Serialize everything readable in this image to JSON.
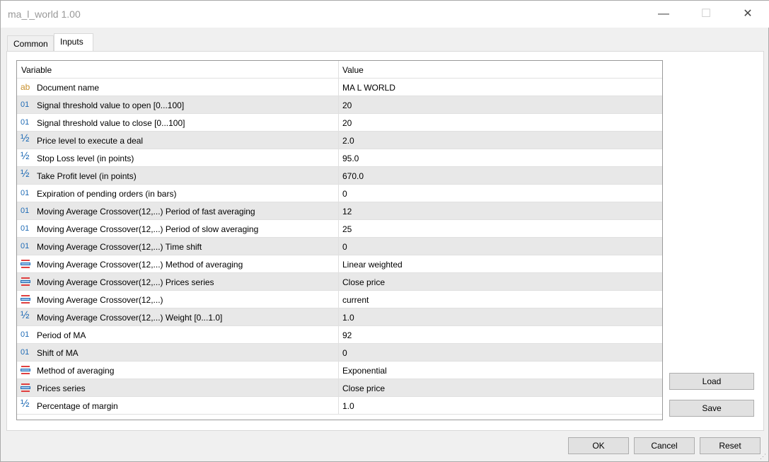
{
  "window": {
    "title": "ma_l_world 1.00",
    "minimize": "—",
    "maximize": "☐",
    "close": "✕"
  },
  "tabs": [
    {
      "label": "Common"
    },
    {
      "label": "Inputs"
    }
  ],
  "grid": {
    "headers": {
      "variable": "Variable",
      "value": "Value"
    },
    "rows": [
      {
        "icon": "string",
        "variable": "Document name",
        "value": "MA L WORLD"
      },
      {
        "icon": "int",
        "variable": "Signal threshold value to open [0...100]",
        "value": "20"
      },
      {
        "icon": "int",
        "variable": "Signal threshold value to close [0...100]",
        "value": "20"
      },
      {
        "icon": "double",
        "variable": "Price level to execute a deal",
        "value": "2.0"
      },
      {
        "icon": "double",
        "variable": "Stop Loss level (in points)",
        "value": "95.0"
      },
      {
        "icon": "double",
        "variable": "Take Profit level (in points)",
        "value": "670.0"
      },
      {
        "icon": "int",
        "variable": "Expiration of pending orders (in bars)",
        "value": "0"
      },
      {
        "icon": "int",
        "variable": "Moving Average Crossover(12,...) Period of fast averaging",
        "value": "12"
      },
      {
        "icon": "int",
        "variable": "Moving Average Crossover(12,...) Period of slow averaging",
        "value": "25"
      },
      {
        "icon": "int",
        "variable": "Moving Average Crossover(12,...) Time shift",
        "value": "0"
      },
      {
        "icon": "enum",
        "variable": "Moving Average Crossover(12,...) Method of averaging",
        "value": "Linear weighted"
      },
      {
        "icon": "enum",
        "variable": "Moving Average Crossover(12,...) Prices series",
        "value": "Close price"
      },
      {
        "icon": "enum",
        "variable": "Moving Average Crossover(12,...)",
        "value": "current"
      },
      {
        "icon": "double",
        "variable": "Moving Average Crossover(12,...) Weight [0...1.0]",
        "value": "1.0"
      },
      {
        "icon": "int",
        "variable": "Period of MA",
        "value": "92"
      },
      {
        "icon": "int",
        "variable": "Shift of MA",
        "value": "0"
      },
      {
        "icon": "enum",
        "variable": "Method of averaging",
        "value": "Exponential"
      },
      {
        "icon": "enum",
        "variable": "Prices series",
        "value": "Close price"
      },
      {
        "icon": "double",
        "variable": "Percentage of margin",
        "value": "1.0"
      }
    ]
  },
  "icons": {
    "string": "ab",
    "int": "01",
    "double": "½"
  },
  "buttons": {
    "load": "Load",
    "save": "Save",
    "ok": "OK",
    "cancel": "Cancel",
    "reset": "Reset"
  }
}
